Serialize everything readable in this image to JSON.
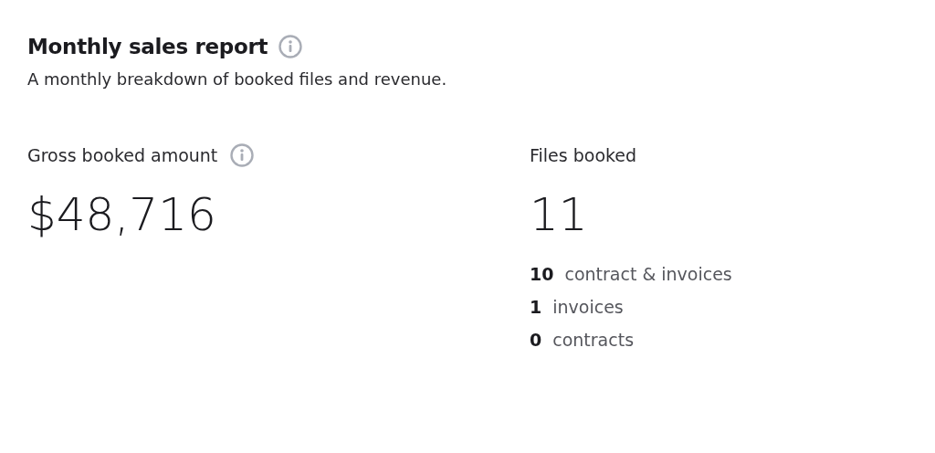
{
  "header": {
    "title": "Monthly sales report",
    "info": true,
    "subtitle": "A monthly breakdown of booked files and revenue."
  },
  "metrics": [
    {
      "label": "Gross booked amount",
      "info": true,
      "value": "$48,716"
    },
    {
      "label": "Files booked",
      "info": false,
      "value": "11",
      "breakdown": [
        {
          "count": "10",
          "label": "contract & invoices"
        },
        {
          "count": "1",
          "label": "invoices"
        },
        {
          "count": "0",
          "label": "contracts"
        }
      ]
    }
  ]
}
